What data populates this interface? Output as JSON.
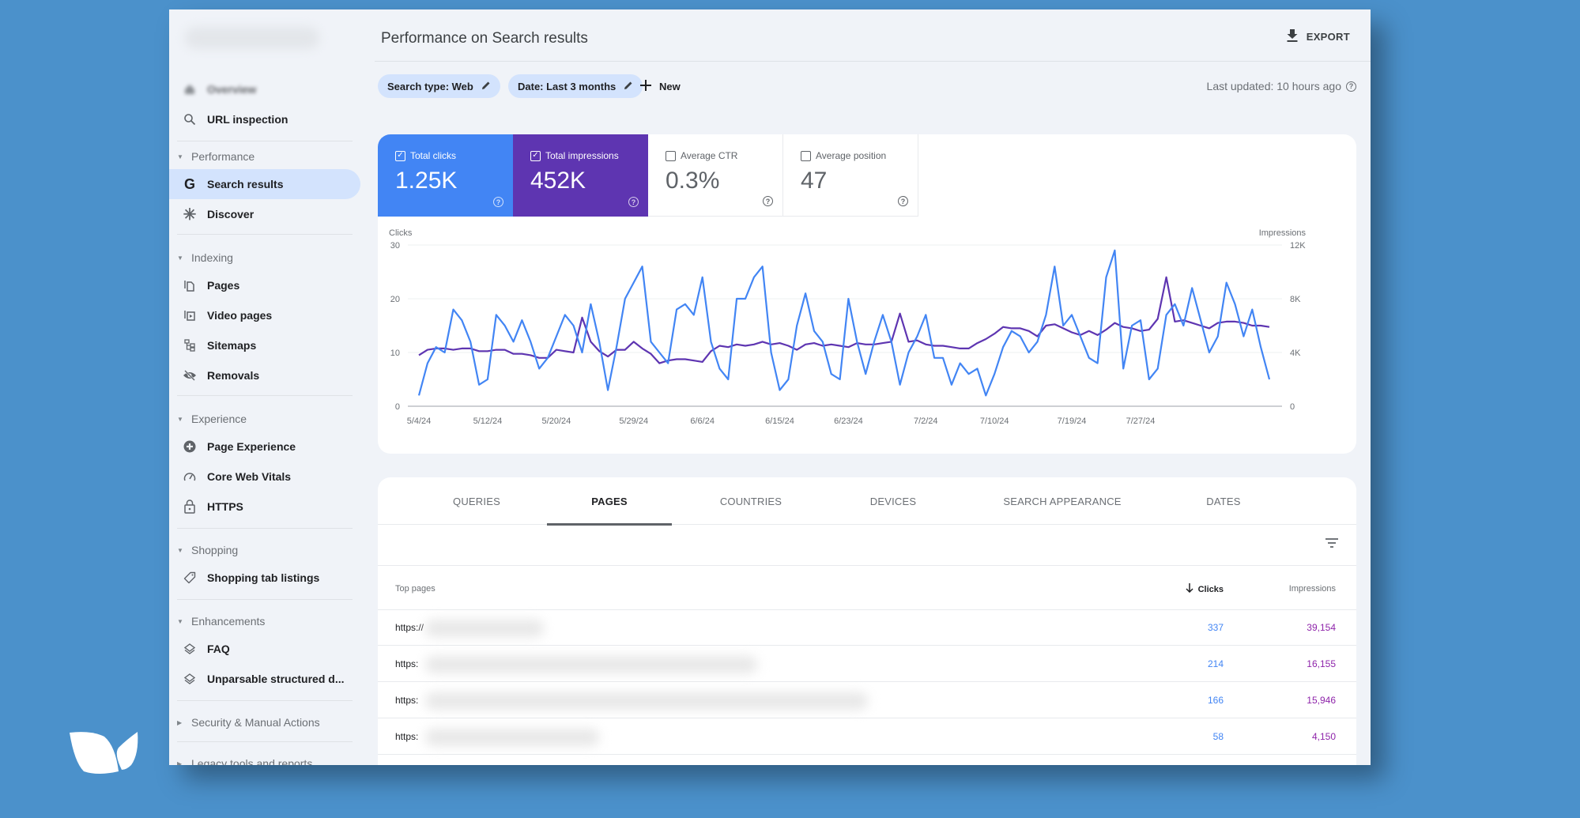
{
  "sidebar": {
    "property_name": "",
    "items": [
      {
        "label": "Overview",
        "icon": "home-icon",
        "blurred": true
      },
      {
        "label": "URL inspection",
        "icon": "search-icon"
      },
      {
        "section": "Performance"
      },
      {
        "label": "Search results",
        "icon": "google-g-icon",
        "active": true
      },
      {
        "label": "Discover",
        "icon": "asterisk-icon"
      },
      {
        "section": "Indexing"
      },
      {
        "label": "Pages",
        "icon": "pages-icon"
      },
      {
        "label": "Video pages",
        "icon": "video-pages-icon"
      },
      {
        "label": "Sitemaps",
        "icon": "sitemap-icon"
      },
      {
        "label": "Removals",
        "icon": "eye-off-icon"
      },
      {
        "section": "Experience"
      },
      {
        "label": "Page Experience",
        "icon": "plus-circle-icon"
      },
      {
        "label": "Core Web Vitals",
        "icon": "gauge-icon"
      },
      {
        "label": "HTTPS",
        "icon": "lock-icon"
      },
      {
        "section": "Shopping"
      },
      {
        "label": "Shopping tab listings",
        "icon": "tag-icon"
      },
      {
        "section": "Enhancements"
      },
      {
        "label": "FAQ",
        "icon": "layers-icon"
      },
      {
        "label": "Unparsable structured d...",
        "icon": "layers-icon"
      },
      {
        "section": "Security & Manual Actions",
        "collapsed": true
      },
      {
        "section": "Legacy tools and reports",
        "collapsed": true
      }
    ]
  },
  "header": {
    "title": "Performance on Search results",
    "export_label": "EXPORT",
    "last_updated": "Last updated: 10 hours ago"
  },
  "filters": {
    "search_type": "Search type: Web",
    "date": "Date: Last 3 months",
    "new_label": "New"
  },
  "metrics": [
    {
      "label": "Total clicks",
      "value": "1.25K",
      "checked": true,
      "color": "#4285f4"
    },
    {
      "label": "Total impressions",
      "value": "452K",
      "checked": true,
      "color": "#5e35b1"
    },
    {
      "label": "Average CTR",
      "value": "0.3%",
      "checked": false
    },
    {
      "label": "Average position",
      "value": "47",
      "checked": false
    }
  ],
  "chart_data": {
    "type": "line",
    "left_axis_label": "Clicks",
    "right_axis_label": "Impressions",
    "left_ylim": [
      0,
      30
    ],
    "right_ylim": [
      0,
      12000
    ],
    "left_ticks": [
      "0",
      "10",
      "20",
      "30"
    ],
    "right_ticks": [
      "0",
      "4K",
      "8K",
      "12K"
    ],
    "x_tick_labels": [
      "5/4/24",
      "5/12/24",
      "5/20/24",
      "5/29/24",
      "6/6/24",
      "6/15/24",
      "6/23/24",
      "7/2/24",
      "7/10/24",
      "7/19/24",
      "7/27/24"
    ],
    "x_tick_index": [
      0,
      8,
      16,
      25,
      33,
      42,
      50,
      59,
      67,
      76,
      84
    ],
    "grid": true,
    "series": [
      {
        "name": "Clicks",
        "axis": "left",
        "color": "#4285f4",
        "values": [
          2,
          8,
          11,
          10,
          18,
          16,
          12,
          4,
          5,
          17,
          15,
          12,
          16,
          12,
          7,
          9,
          13,
          17,
          15,
          10,
          19,
          12,
          3,
          11,
          20,
          23,
          26,
          12,
          10,
          8,
          18,
          19,
          17,
          24,
          12,
          7,
          5,
          20,
          20,
          24,
          26,
          10,
          3,
          5,
          15,
          21,
          14,
          12,
          6,
          5,
          20,
          12,
          6,
          12,
          17,
          12,
          4,
          10,
          13,
          17,
          9,
          9,
          4,
          8,
          6,
          7,
          2,
          6,
          11,
          14,
          13,
          10,
          12,
          17,
          26,
          15,
          17,
          13,
          9,
          8,
          24,
          29,
          7,
          15,
          16,
          5,
          7,
          17,
          19,
          15,
          22,
          16,
          10,
          13,
          23,
          19,
          13,
          18,
          11,
          5
        ]
      },
      {
        "name": "Impressions",
        "axis": "right",
        "color": "#5e35b1",
        "values": [
          3800,
          4200,
          4300,
          4300,
          4200,
          4300,
          4300,
          4100,
          4100,
          4200,
          4200,
          3900,
          3900,
          3800,
          3600,
          3600,
          4200,
          4100,
          4000,
          6600,
          4800,
          4100,
          3700,
          4200,
          4200,
          4800,
          4300,
          3900,
          3200,
          3400,
          3500,
          3500,
          3400,
          3300,
          4100,
          4500,
          4400,
          4600,
          4500,
          4600,
          4800,
          4600,
          4700,
          4500,
          4200,
          4600,
          4700,
          4500,
          4600,
          4500,
          4400,
          4700,
          4600,
          4600,
          4700,
          4800,
          6900,
          4800,
          4900,
          4600,
          4500,
          4500,
          4400,
          4300,
          4300,
          4700,
          5000,
          5400,
          5900,
          5800,
          5800,
          5600,
          5200,
          6000,
          6100,
          5800,
          5500,
          5300,
          5600,
          5300,
          5700,
          6200,
          5900,
          5800,
          5600,
          5700,
          6500,
          9600,
          6300,
          6400,
          6200,
          6000,
          5800,
          6200,
          6300,
          6300,
          6200,
          6000,
          6000,
          5900
        ]
      }
    ]
  },
  "table": {
    "tabs": [
      "QUERIES",
      "PAGES",
      "COUNTRIES",
      "DEVICES",
      "SEARCH APPEARANCE",
      "DATES"
    ],
    "active_tab": "PAGES",
    "columns": {
      "page": "Top pages",
      "clicks": "Clicks",
      "impressions": "Impressions"
    },
    "rows": [
      {
        "url": "https://",
        "clicks": "337",
        "impressions": "39,154"
      },
      {
        "url": "https:",
        "clicks": "214",
        "impressions": "16,155"
      },
      {
        "url": "https:",
        "clicks": "166",
        "impressions": "15,946"
      },
      {
        "url": "https:",
        "clicks": "58",
        "impressions": "4,150"
      }
    ]
  }
}
